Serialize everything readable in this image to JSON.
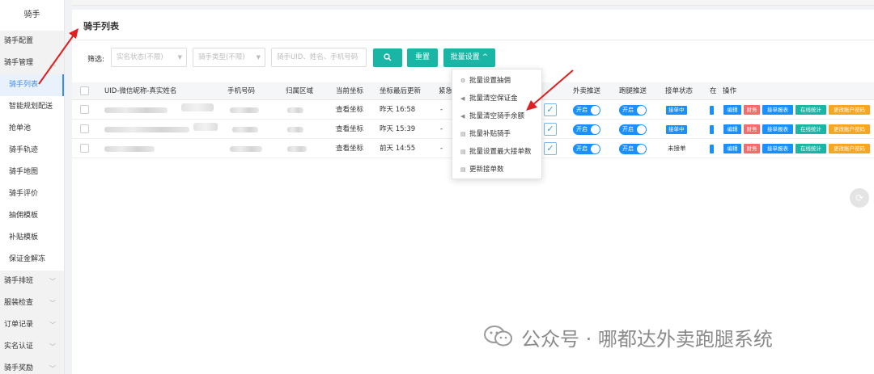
{
  "sidebar": {
    "title": "骑手",
    "items": [
      {
        "label": "骑手配置",
        "type": "group",
        "chevron": false
      },
      {
        "label": "骑手管理",
        "type": "group",
        "chevron": true
      },
      {
        "label": "骑手列表",
        "type": "sub",
        "active": true
      },
      {
        "label": "智能规划配送",
        "type": "sub"
      },
      {
        "label": "抢单池",
        "type": "sub"
      },
      {
        "label": "骑手轨迹",
        "type": "sub"
      },
      {
        "label": "骑手地图",
        "type": "sub"
      },
      {
        "label": "骑手评价",
        "type": "sub"
      },
      {
        "label": "抽佣模板",
        "type": "sub"
      },
      {
        "label": "补贴模板",
        "type": "sub"
      },
      {
        "label": "保证金解冻",
        "type": "sub"
      },
      {
        "label": "骑手排班",
        "type": "group",
        "chevron": true
      },
      {
        "label": "服装检查",
        "type": "group",
        "chevron": true
      },
      {
        "label": "订单记录",
        "type": "group",
        "chevron": true
      },
      {
        "label": "实名认证",
        "type": "group",
        "chevron": true
      },
      {
        "label": "骑手奖励",
        "type": "group",
        "chevron": true
      }
    ]
  },
  "page": {
    "title": "骑手列表"
  },
  "filter": {
    "label": "筛选:",
    "status_placeholder": "实名状态(不限)",
    "type_placeholder": "骑手类型(不限)",
    "search_placeholder": "骑手UID、姓名、手机号码",
    "search_icon": "search-icon",
    "reset_label": "重置",
    "batch_label": "批量设置 ^"
  },
  "table": {
    "headers": [
      "UID-微信昵称-真实姓名",
      "手机号码",
      "归属区域",
      "当前坐标",
      "坐标最后更新",
      "紧急",
      "外卖推送",
      "跑腿推送",
      "接单状态",
      "在",
      "操作"
    ],
    "rows": [
      {
        "coord": "查看坐标",
        "updated": "昨天 16:58",
        "urgent": "-",
        "waimai": "开启",
        "paotui": "开启",
        "status": "接单中"
      },
      {
        "coord": "查看坐标",
        "updated": "昨天 15:39",
        "urgent": "-",
        "waimai": "开启",
        "paotui": "开启",
        "status": "接单中"
      },
      {
        "coord": "查看坐标",
        "updated": "前天 14:55",
        "urgent": "-",
        "waimai": "开启",
        "paotui": "开启",
        "status": "未接单"
      }
    ],
    "ops": [
      "编辑",
      "财务",
      "接单报表",
      "在线统计",
      "更改账户密码"
    ]
  },
  "dropdown": {
    "items": [
      {
        "label": "批量设置抽佣",
        "icon": "gear-icon"
      },
      {
        "label": "批量清空保证金",
        "icon": "megaphone-icon"
      },
      {
        "label": "批量清空骑手余额",
        "icon": "megaphone-icon"
      },
      {
        "label": "批量补贴骑手",
        "icon": "document-icon"
      },
      {
        "label": "批量设置最大接单数",
        "icon": "document-icon"
      },
      {
        "label": "更新接单数",
        "icon": "document-icon"
      }
    ]
  },
  "watermark": {
    "text": "公众号 · 哪都达外卖跑腿系统"
  },
  "colors": {
    "teal": "#19b5a5",
    "blue": "#1890ff",
    "red": "#f56c6c",
    "orange": "#f5a623",
    "annotation": "#e02020"
  }
}
